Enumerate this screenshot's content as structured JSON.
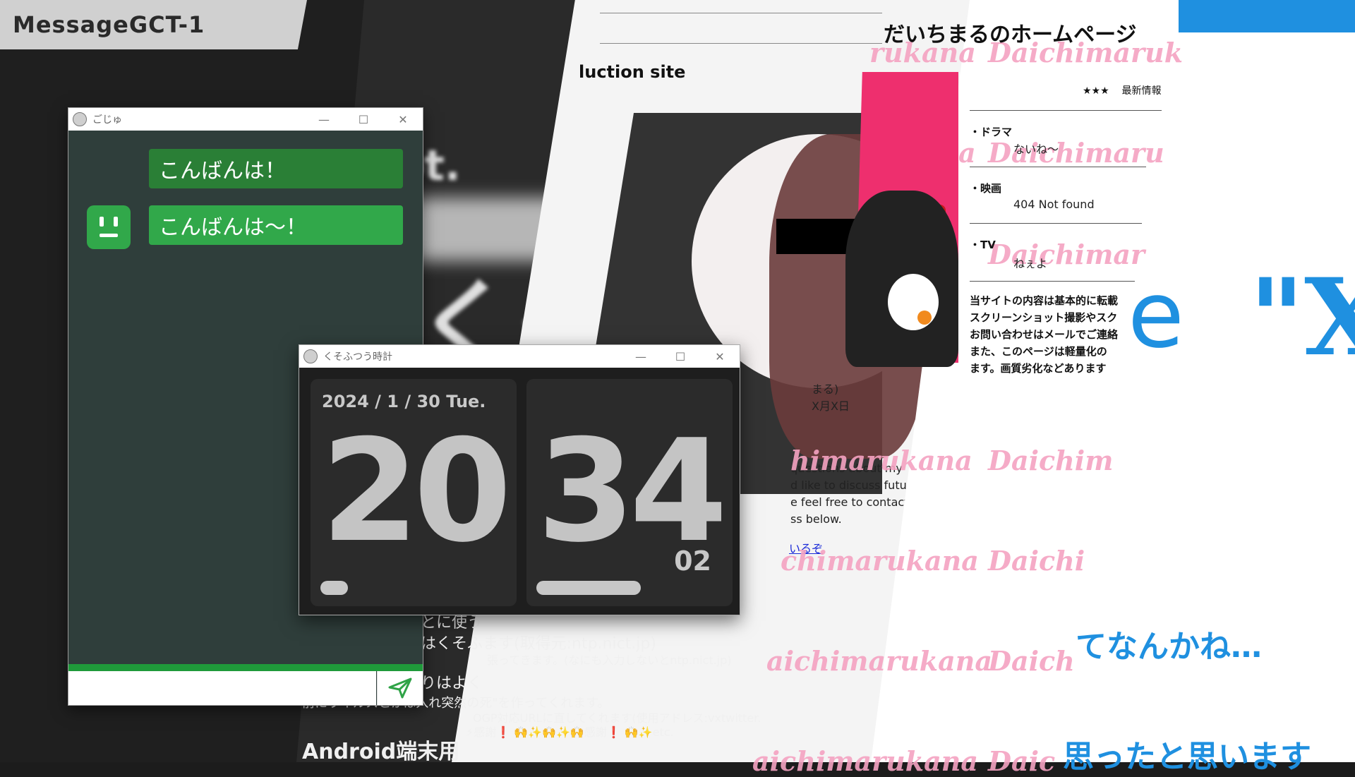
{
  "app_label": "MessageGCT-1",
  "background_site": {
    "title": "luction site",
    "body_lines": [
      "questions about my",
      "d like to discuss future",
      "e feel free to contact me at",
      "ss below."
    ],
    "meta_lines": [
      "まる)",
      "X月X日"
    ],
    "link_text": "いるぞ"
  },
  "daichimaru_page": {
    "title": "だいちまるのホームページ",
    "stars": "★★★",
    "latest_label": "最新情報",
    "watermark_words": [
      "rukana",
      "Daichimaruk",
      "a",
      "Daichimaru",
      "Daichimar",
      "himarukana",
      "Daichim",
      "chimarukana",
      "Daichi",
      "aichimarukana",
      "Daich",
      "aichimarukana",
      "Daic"
    ],
    "sections": [
      {
        "label": "・ドラマ",
        "value": "ないね～"
      },
      {
        "label": "・映画",
        "value": "404 Not found"
      },
      {
        "label": "・TV",
        "value": "ねぇよ"
      }
    ],
    "notice_lines": [
      "当サイトの内容は基本的に転載",
      "スクリーンショット撮影やスク",
      "お問い合わせはメールでご連絡",
      "また、このページは軽量化の",
      "ます。画質劣化などあります"
    ]
  },
  "right_text": {
    "big_e": "e",
    "big_x": "\"X",
    "line1": "てなんかね…",
    "line2": "思ったと思います"
  },
  "bg_text_lines": [
    "とに使う",
    "はくそふます(取得元:ntp.nict.jp)",
    "張ってきます。(なにも入力しないとntp.nict.jp)",
    "りはよく",
    "前にウイルスとかは入れ突然の死\"を作ってくれます。",
    "OGP対応URLに直してくれます(使用アドレス:vxtwitter.",
    "⚡感謝❗ 🙌✨🙌✨🙌感謝❗ 🙌✨etc."
  ],
  "bg_heading": "Android端末用",
  "bg_blur_words": [
    "くそ",
    "ot."
  ],
  "chat_window": {
    "title": "ごじゅ",
    "messages": [
      {
        "text": "こんばんは！",
        "from": "user"
      },
      {
        "text": "こんばんは～！",
        "from": "bot"
      }
    ],
    "input_value": "",
    "accent": "#31a84a"
  },
  "clock_window": {
    "title": "くそふつう時計",
    "date": "2024 / 1 / 30   Tue.",
    "hour": "20",
    "minute": "34",
    "second": "02",
    "hour_progress": 0.15,
    "minute_progress": 0.57
  },
  "window_controls": {
    "minimize": "—",
    "maximize": "☐",
    "close": "✕"
  },
  "colors": {
    "blue": "#1f90e0",
    "pink_watermark": "#f5a3c2",
    "chat_bg": "#2f3e3b"
  }
}
